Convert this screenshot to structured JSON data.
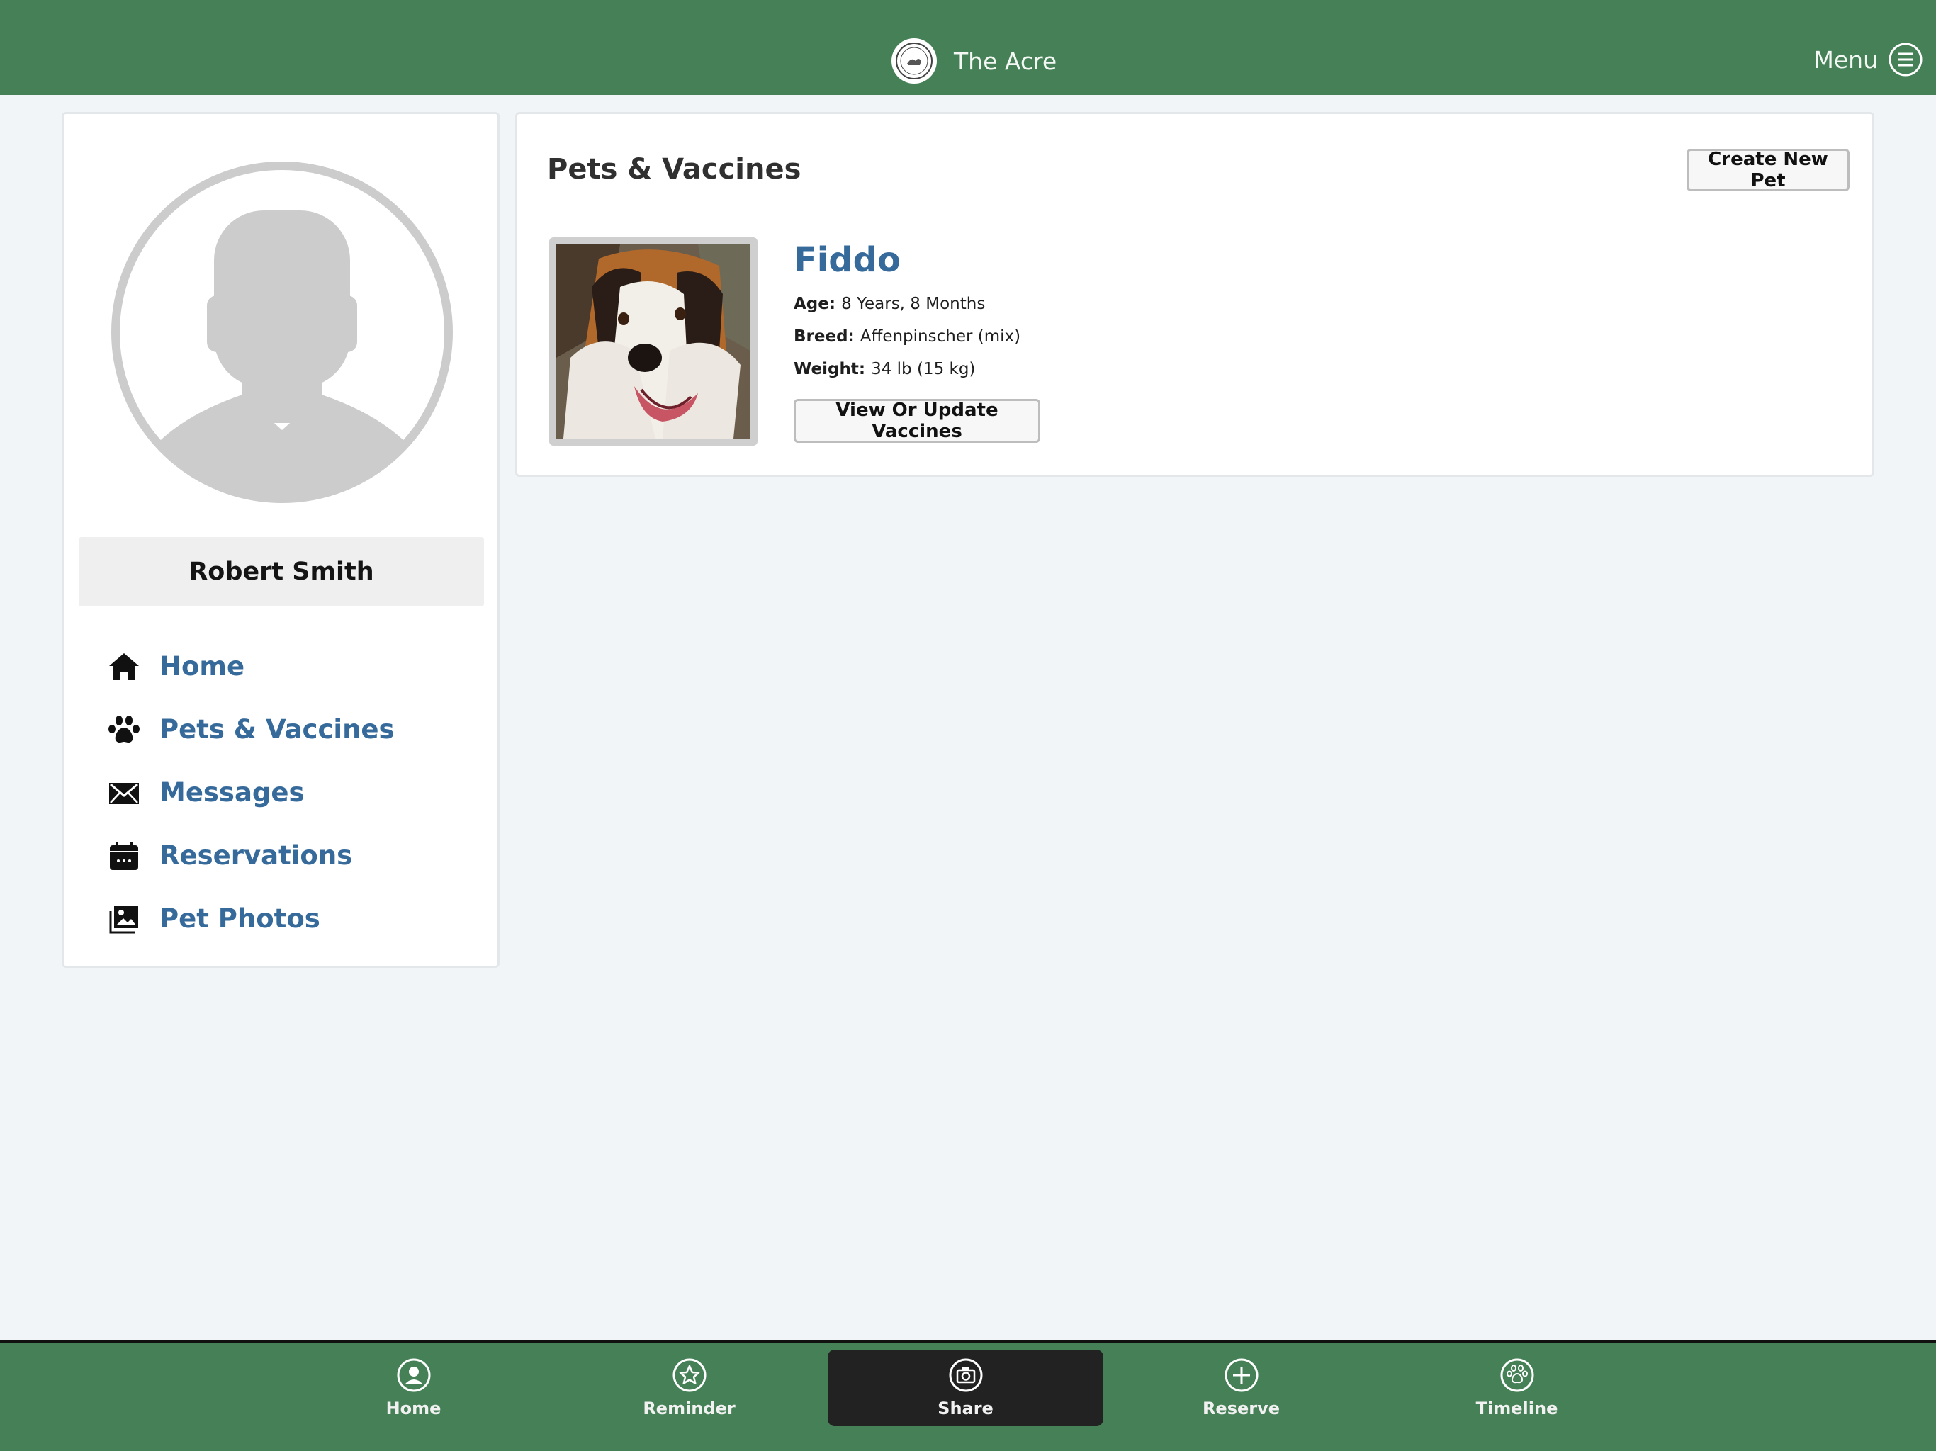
{
  "header": {
    "title": "The Acre",
    "menu_label": "Menu"
  },
  "sidebar": {
    "user_name": "Robert Smith",
    "items": [
      {
        "label": "Home",
        "icon": "home-icon"
      },
      {
        "label": "Pets & Vaccines",
        "icon": "paw-icon"
      },
      {
        "label": "Messages",
        "icon": "envelope-icon"
      },
      {
        "label": "Reservations",
        "icon": "calendar-icon"
      },
      {
        "label": "Pet Photos",
        "icon": "photos-icon"
      }
    ]
  },
  "main": {
    "title": "Pets & Vaccines",
    "create_button": "Create New Pet",
    "pet": {
      "name": "Fiddo",
      "age_label": "Age:",
      "age": "8 Years, 8 Months",
      "breed_label": "Breed:",
      "breed": "Affenpinscher (mix)",
      "weight_label": "Weight:",
      "weight": "34 lb (15 kg)",
      "vaccines_button": "View Or Update Vaccines"
    }
  },
  "bottom_nav": {
    "tabs": [
      {
        "label": "Home",
        "icon": "user-circle-icon"
      },
      {
        "label": "Reminder",
        "icon": "star-icon"
      },
      {
        "label": "Share",
        "icon": "camera-icon",
        "active": true
      },
      {
        "label": "Reserve",
        "icon": "plus-circle-icon"
      },
      {
        "label": "Timeline",
        "icon": "paw-circle-icon"
      }
    ]
  },
  "colors": {
    "brand_green": "#458056",
    "link_blue": "#356a9b",
    "background": "#f1f5f8",
    "active_tab": "#222222"
  }
}
